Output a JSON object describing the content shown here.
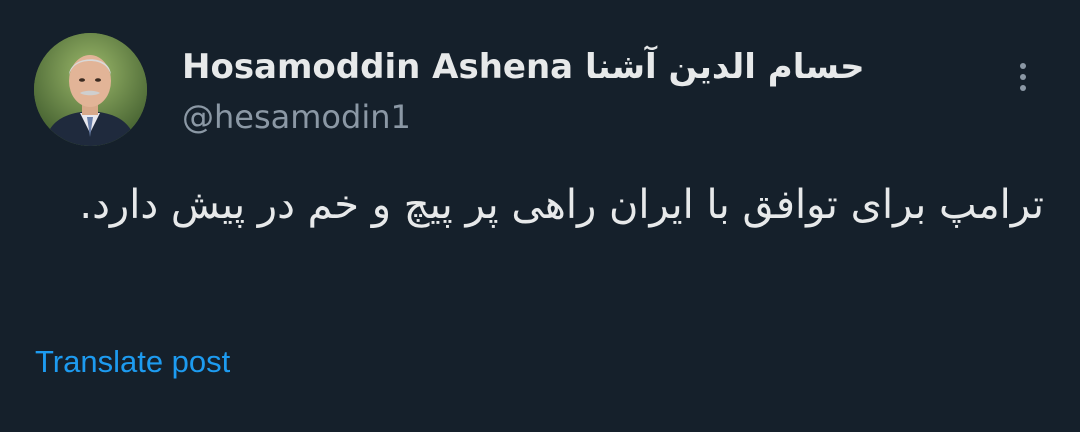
{
  "post": {
    "author": {
      "display_name": "Hosamoddin Ashena حسام الدین آشنا",
      "handle": "@hesamodin1",
      "avatar_icon": "person-portrait"
    },
    "text": "ترامپ برای توافق با ایران راهی پر پیچ و خم در پیش دارد.",
    "translate_label": "Translate post",
    "more_icon": "vertical-ellipsis-icon"
  },
  "colors": {
    "background": "#15202b",
    "primary_text": "#e7e9ea",
    "secondary_text": "#8b98a5",
    "link": "#1d9bf0"
  }
}
